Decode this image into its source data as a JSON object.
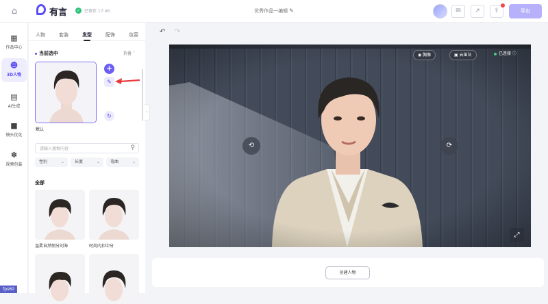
{
  "topbar": {
    "app_name": "有言",
    "saved_text": "已保存 17:46",
    "doc_title": "优秀作品一编辑",
    "export_label": "导出",
    "icons": [
      "home-icon",
      "mail-icon",
      "share-icon",
      "upload-icon"
    ]
  },
  "leftnav": {
    "items": [
      {
        "label": "作品中心",
        "icon": "grid-icon"
      },
      {
        "label": "3D人物",
        "icon": "avatar-3d-icon",
        "active": true
      },
      {
        "label": "AI生成",
        "icon": "chart-icon"
      },
      {
        "label": "镜头优化",
        "icon": "camera-icon"
      },
      {
        "label": "视频包装",
        "icon": "package-icon"
      }
    ],
    "fps_label": "fps60"
  },
  "panel": {
    "tabs": [
      {
        "label": "人物"
      },
      {
        "label": "套装"
      },
      {
        "label": "发型",
        "active": true
      },
      {
        "label": "配饰"
      },
      {
        "label": "妆容"
      }
    ],
    "current_heading": "当前选中",
    "collapse_label": "折叠 ˄",
    "current_name": "默认",
    "search_placeholder": "请输入搜索内容",
    "filters": [
      {
        "label": "性别"
      },
      {
        "label": "长度"
      },
      {
        "label": "弯曲"
      }
    ],
    "all_heading": "全部",
    "hairstyles": [
      {
        "label": "温柔自然侧分刘海"
      },
      {
        "label": "时尚内扣中分"
      },
      {
        "label": ""
      },
      {
        "label": ""
      }
    ]
  },
  "viewport": {
    "controls": [
      {
        "label": "胸像"
      },
      {
        "label": "云笛灰"
      }
    ],
    "status_label": "已连接 ⓘ"
  },
  "bottom": {
    "create_label": "创建人物"
  },
  "colors": {
    "accent": "#5a4ef5",
    "export_button": "#b7b1fb",
    "active_nav_bg": "#eeedfe",
    "viewport_bg": "#3c4452"
  }
}
